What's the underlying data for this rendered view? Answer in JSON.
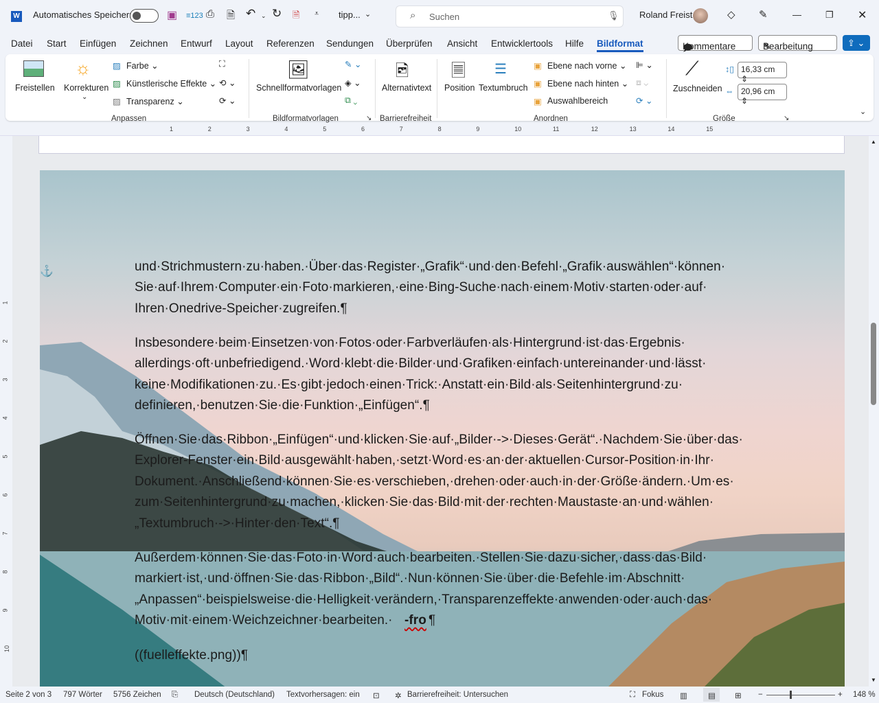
{
  "titlebar": {
    "autosave_label": "Automatisches Speichern",
    "doc_name": "tipp...",
    "search_placeholder": "Suchen",
    "user_name": "Roland Freist"
  },
  "menu": {
    "tabs": [
      "Datei",
      "Start",
      "Einfügen",
      "Zeichnen",
      "Entwurf",
      "Layout",
      "Referenzen",
      "Sendungen",
      "Überprüfen",
      "Ansicht",
      "Entwicklertools",
      "Hilfe",
      "Bildformat"
    ],
    "active": "Bildformat",
    "comments": "Kommentare",
    "editing": "Bearbeitung"
  },
  "ribbon": {
    "freistellen": "Freistellen",
    "korrekturen": "Korrekturen",
    "farbe": "Farbe",
    "effekte": "Künstlerische Effekte",
    "transparenz": "Transparenz",
    "group_anpassen": "Anpassen",
    "schnellformat": "Schnellformatvorlagen",
    "group_bildformat": "Bildformatvorlagen",
    "alternativtext": "Alternativtext",
    "group_barriere": "Barrierefreiheit",
    "position": "Position",
    "textumbruch": "Textumbruch",
    "vorne": "Ebene nach vorne",
    "hinten": "Ebene nach hinten",
    "auswahl": "Auswahlbereich",
    "group_anordnen": "Anordnen",
    "zuschneiden": "Zuschneiden",
    "height": "16,33 cm",
    "width": "20,96 cm",
    "group_groesse": "Größe"
  },
  "ruler": {
    "ticks": [
      "1",
      "2",
      "3",
      "4",
      "5",
      "6",
      "7",
      "8",
      "9",
      "10",
      "11",
      "12",
      "13",
      "14",
      "15"
    ],
    "vticks": [
      "1",
      "2",
      "3",
      "4",
      "5",
      "6",
      "7",
      "8",
      "9",
      "10"
    ]
  },
  "document": {
    "lines": [
      "und·Strichmustern·zu·haben.·Über·das·Register·„Grafik“·und·den·Befehl·„Grafik·auswählen“·können·",
      "Sie·auf·Ihrem·Computer·ein·Foto·markieren,·eine·Bing-Suche·nach·einem·Motiv·starten·oder·auf·",
      "Ihren·Onedrive-Speicher·zugreifen.¶",
      "Insbesondere·beim·Einsetzen·von·Fotos·oder·Farbverläufen·als·Hintergrund·ist·das·Ergebnis·",
      "allerdings·oft·unbefriedigend.·Word·klebt·die·Bilder·und·Grafiken·einfach·untereinander·und·lässt·",
      "keine·Modifikationen·zu.·Es·gibt·jedoch·einen·Trick:·Anstatt·ein·Bild·als·Seitenhintergrund·zu·",
      "definieren,·benutzen·Sie·die·Funktion·„Einfügen“.¶",
      "Öffnen·Sie·das·Ribbon·„Einfügen“·und·klicken·Sie·auf·„Bilder·->·Dieses·Gerät“.·Nachdem·Sie·über·das·",
      "Explorer-Fenster·ein·Bild·ausgewählt·haben,·setzt·Word·es·an·der·aktuellen·Cursor-Position·in·Ihr·",
      "Dokument.·Anschließend·können·Sie·es·verschieben,·drehen·oder·auch·in·der·Größe·ändern.·Um·es·",
      "zum·Seitenhintergrund·zu·machen,·klicken·Sie·das·Bild·mit·der·rechten·Maustaste·an·und·wählen·",
      "„Textumbruch·->·Hinter·den·Text“.¶",
      "Außerdem·können·Sie·das·Foto·in·Word·auch·bearbeiten.·Stellen·Sie·dazu·sicher,·dass·das·Bild·",
      "markiert·ist,·und·öffnen·Sie·das·Ribbon·„Bild“.·Nun·können·Sie·über·die·Befehle·im·Abschnitt·",
      "„Anpassen“·beispielsweise·die·Helligkeit·verändern,·Transparenzeffekte·anwenden·oder·auch·das·",
      "Motiv·mit·einem·Weichzeichner·bearbeiten.·",
      "-fro",
      "¶",
      "((fuelleffekte.png))¶"
    ]
  },
  "status": {
    "page": "Seite 2 von 3",
    "words": "797 Wörter",
    "chars": "5756 Zeichen",
    "language": "Deutsch (Deutschland)",
    "predictions": "Textvorhersagen: ein",
    "accessibility": "Barrierefreiheit: Untersuchen",
    "focus": "Fokus",
    "zoom": "148 %",
    "zoom_level": 148
  },
  "colors": {
    "accent": "#185abd",
    "share": "#0f6cbd"
  }
}
